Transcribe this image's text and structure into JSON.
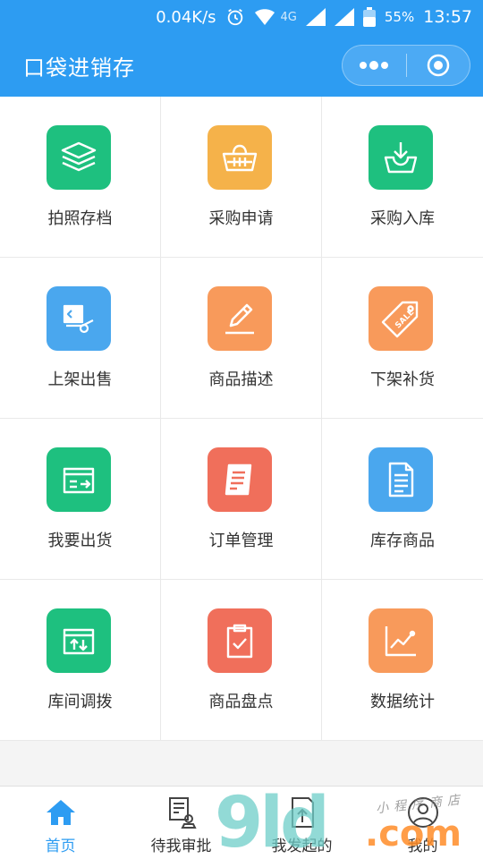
{
  "status_bar": {
    "net_speed": "0.04K/s",
    "net_type": "4G",
    "battery": "55%",
    "time": "13:57"
  },
  "nav": {
    "title": "口袋进销存"
  },
  "colors": {
    "primary": "#2d9cf2",
    "green": "#1ec07f",
    "yellow": "#f5b24a",
    "orange": "#f89a5b",
    "red": "#f06f5b",
    "blue": "#4aa7ee"
  },
  "grid": [
    {
      "label": "拍照存档",
      "icon": "layers-icon",
      "color": "#1ec07f"
    },
    {
      "label": "采购申请",
      "icon": "basket-icon",
      "color": "#f5b24a"
    },
    {
      "label": "采购入库",
      "icon": "inbox-download-icon",
      "color": "#1ec07f"
    },
    {
      "label": "上架出售",
      "icon": "hand-truck-icon",
      "color": "#4aa7ee"
    },
    {
      "label": "商品描述",
      "icon": "pencil-icon",
      "color": "#f89a5b"
    },
    {
      "label": "下架补货",
      "icon": "sale-tag-icon",
      "color": "#f89a5b"
    },
    {
      "label": "我要出货",
      "icon": "box-out-icon",
      "color": "#1ec07f"
    },
    {
      "label": "订单管理",
      "icon": "receipt-icon",
      "color": "#f06f5b"
    },
    {
      "label": "库存商品",
      "icon": "document-icon",
      "color": "#4aa7ee"
    },
    {
      "label": "库间调拨",
      "icon": "box-transfer-icon",
      "color": "#1ec07f"
    },
    {
      "label": "商品盘点",
      "icon": "clipboard-check-icon",
      "color": "#f06f5b"
    },
    {
      "label": "数据统计",
      "icon": "line-chart-icon",
      "color": "#f89a5b"
    }
  ],
  "tabs": [
    {
      "label": "首页",
      "icon": "home-icon",
      "active": true
    },
    {
      "label": "待我审批",
      "icon": "approval-icon",
      "active": false
    },
    {
      "label": "我发起的",
      "icon": "upload-doc-icon",
      "active": false
    },
    {
      "label": "我的",
      "icon": "user-icon",
      "active": false
    }
  ],
  "watermark": {
    "number": "9ld",
    "domain": ".com",
    "shop": "小程序商店"
  }
}
